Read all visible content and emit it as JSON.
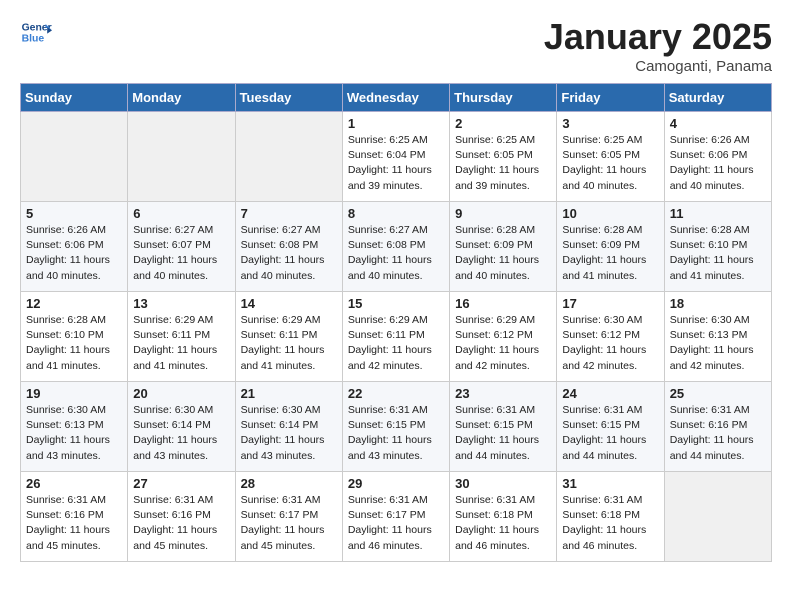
{
  "header": {
    "logo_line1": "General",
    "logo_line2": "Blue",
    "title": "January 2025",
    "subtitle": "Camoganti, Panama"
  },
  "weekdays": [
    "Sunday",
    "Monday",
    "Tuesday",
    "Wednesday",
    "Thursday",
    "Friday",
    "Saturday"
  ],
  "weeks": [
    [
      {
        "day": "",
        "info": ""
      },
      {
        "day": "",
        "info": ""
      },
      {
        "day": "",
        "info": ""
      },
      {
        "day": "1",
        "info": "Sunrise: 6:25 AM\nSunset: 6:04 PM\nDaylight: 11 hours\nand 39 minutes."
      },
      {
        "day": "2",
        "info": "Sunrise: 6:25 AM\nSunset: 6:05 PM\nDaylight: 11 hours\nand 39 minutes."
      },
      {
        "day": "3",
        "info": "Sunrise: 6:25 AM\nSunset: 6:05 PM\nDaylight: 11 hours\nand 40 minutes."
      },
      {
        "day": "4",
        "info": "Sunrise: 6:26 AM\nSunset: 6:06 PM\nDaylight: 11 hours\nand 40 minutes."
      }
    ],
    [
      {
        "day": "5",
        "info": "Sunrise: 6:26 AM\nSunset: 6:06 PM\nDaylight: 11 hours\nand 40 minutes."
      },
      {
        "day": "6",
        "info": "Sunrise: 6:27 AM\nSunset: 6:07 PM\nDaylight: 11 hours\nand 40 minutes."
      },
      {
        "day": "7",
        "info": "Sunrise: 6:27 AM\nSunset: 6:08 PM\nDaylight: 11 hours\nand 40 minutes."
      },
      {
        "day": "8",
        "info": "Sunrise: 6:27 AM\nSunset: 6:08 PM\nDaylight: 11 hours\nand 40 minutes."
      },
      {
        "day": "9",
        "info": "Sunrise: 6:28 AM\nSunset: 6:09 PM\nDaylight: 11 hours\nand 40 minutes."
      },
      {
        "day": "10",
        "info": "Sunrise: 6:28 AM\nSunset: 6:09 PM\nDaylight: 11 hours\nand 41 minutes."
      },
      {
        "day": "11",
        "info": "Sunrise: 6:28 AM\nSunset: 6:10 PM\nDaylight: 11 hours\nand 41 minutes."
      }
    ],
    [
      {
        "day": "12",
        "info": "Sunrise: 6:28 AM\nSunset: 6:10 PM\nDaylight: 11 hours\nand 41 minutes."
      },
      {
        "day": "13",
        "info": "Sunrise: 6:29 AM\nSunset: 6:11 PM\nDaylight: 11 hours\nand 41 minutes."
      },
      {
        "day": "14",
        "info": "Sunrise: 6:29 AM\nSunset: 6:11 PM\nDaylight: 11 hours\nand 41 minutes."
      },
      {
        "day": "15",
        "info": "Sunrise: 6:29 AM\nSunset: 6:11 PM\nDaylight: 11 hours\nand 42 minutes."
      },
      {
        "day": "16",
        "info": "Sunrise: 6:29 AM\nSunset: 6:12 PM\nDaylight: 11 hours\nand 42 minutes."
      },
      {
        "day": "17",
        "info": "Sunrise: 6:30 AM\nSunset: 6:12 PM\nDaylight: 11 hours\nand 42 minutes."
      },
      {
        "day": "18",
        "info": "Sunrise: 6:30 AM\nSunset: 6:13 PM\nDaylight: 11 hours\nand 42 minutes."
      }
    ],
    [
      {
        "day": "19",
        "info": "Sunrise: 6:30 AM\nSunset: 6:13 PM\nDaylight: 11 hours\nand 43 minutes."
      },
      {
        "day": "20",
        "info": "Sunrise: 6:30 AM\nSunset: 6:14 PM\nDaylight: 11 hours\nand 43 minutes."
      },
      {
        "day": "21",
        "info": "Sunrise: 6:30 AM\nSunset: 6:14 PM\nDaylight: 11 hours\nand 43 minutes."
      },
      {
        "day": "22",
        "info": "Sunrise: 6:31 AM\nSunset: 6:15 PM\nDaylight: 11 hours\nand 43 minutes."
      },
      {
        "day": "23",
        "info": "Sunrise: 6:31 AM\nSunset: 6:15 PM\nDaylight: 11 hours\nand 44 minutes."
      },
      {
        "day": "24",
        "info": "Sunrise: 6:31 AM\nSunset: 6:15 PM\nDaylight: 11 hours\nand 44 minutes."
      },
      {
        "day": "25",
        "info": "Sunrise: 6:31 AM\nSunset: 6:16 PM\nDaylight: 11 hours\nand 44 minutes."
      }
    ],
    [
      {
        "day": "26",
        "info": "Sunrise: 6:31 AM\nSunset: 6:16 PM\nDaylight: 11 hours\nand 45 minutes."
      },
      {
        "day": "27",
        "info": "Sunrise: 6:31 AM\nSunset: 6:16 PM\nDaylight: 11 hours\nand 45 minutes."
      },
      {
        "day": "28",
        "info": "Sunrise: 6:31 AM\nSunset: 6:17 PM\nDaylight: 11 hours\nand 45 minutes."
      },
      {
        "day": "29",
        "info": "Sunrise: 6:31 AM\nSunset: 6:17 PM\nDaylight: 11 hours\nand 46 minutes."
      },
      {
        "day": "30",
        "info": "Sunrise: 6:31 AM\nSunset: 6:18 PM\nDaylight: 11 hours\nand 46 minutes."
      },
      {
        "day": "31",
        "info": "Sunrise: 6:31 AM\nSunset: 6:18 PM\nDaylight: 11 hours\nand 46 minutes."
      },
      {
        "day": "",
        "info": ""
      }
    ]
  ]
}
